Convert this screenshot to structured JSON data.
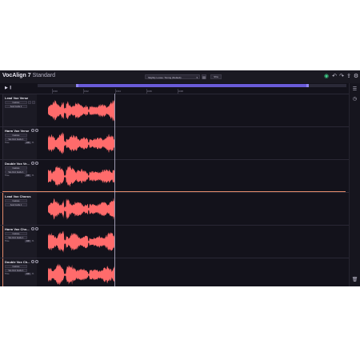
{
  "app": {
    "name": "VocAlign 7",
    "edition": "Standard",
    "preset": "Slightly Loose: Timing (Default)",
    "view_button": "Shw"
  },
  "ruler": {
    "ticks": [
      "0:00",
      "0:02",
      "0:04",
      "0:06",
      "0:08"
    ]
  },
  "tracks": [
    {
      "name": "Lead Vox Verse",
      "mode": "Capture",
      "processing": "Auto Guide 1",
      "has_time": false
    },
    {
      "name": "Harm Vox Verse",
      "mode": "Capture",
      "processing": "Sel-Vent Guide 1",
      "time_label": "Time",
      "time_value": "100",
      "time_unit": "%",
      "has_time": true
    },
    {
      "name": "Double Vox Ve...",
      "mode": "Capture",
      "processing": "Sel-Vent Guide 1",
      "time_label": "Time",
      "time_value": "100",
      "time_unit": "%",
      "has_time": true
    },
    {
      "name": "Lead Vox Chorus",
      "mode": "Capture",
      "processing": "Auto Guide 1",
      "has_time": false
    },
    {
      "name": "Harm Vox Cho...",
      "mode": "Capture",
      "processing": "Sel-Vent Guide 1",
      "time_label": "Time",
      "time_value": "100",
      "time_unit": "%",
      "has_time": true
    },
    {
      "name": "Double Vox Ch...",
      "mode": "Capture",
      "processing": "Sel-Vent Guide 1",
      "time_label": "Time",
      "time_value": "100",
      "time_unit": "%",
      "has_time": true
    }
  ],
  "icons": {
    "status": "check-circle-icon",
    "undo": "undo-icon",
    "redo": "redo-icon",
    "export": "export-icon",
    "settings": "gear-icon",
    "folder": "folder-icon",
    "play": "play-icon",
    "loop": "loop-icon",
    "sidebar_top": "list-icon",
    "sidebar_history": "history-icon",
    "trash": "trash-icon"
  },
  "colors": {
    "waveform": "#ff6b6b",
    "background": "#13121b",
    "selection": "#6a5bd8",
    "accent": "#e38a6a",
    "status_ok": "#3fd18a"
  }
}
